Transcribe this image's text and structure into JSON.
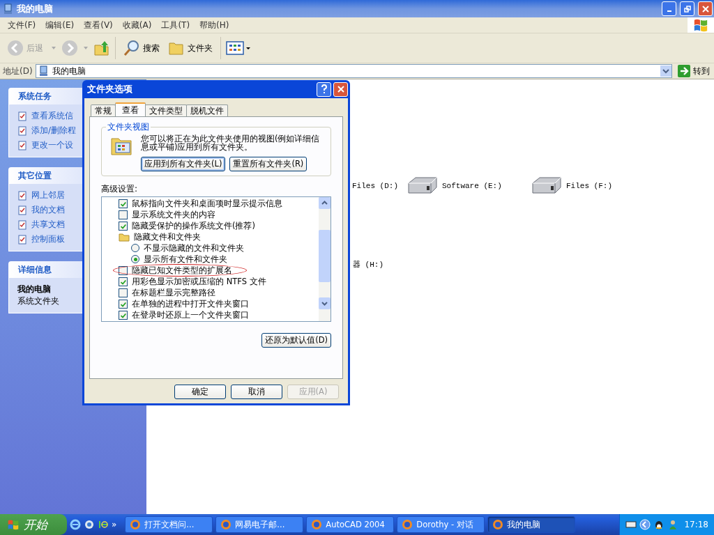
{
  "window": {
    "title": "我的电脑"
  },
  "menu": [
    "文件(F)",
    "编辑(E)",
    "查看(V)",
    "收藏(A)",
    "工具(T)",
    "帮助(H)"
  ],
  "toolbar": {
    "back": {
      "label": "后退",
      "disabled": true
    },
    "search": "搜索",
    "folders": "文件夹"
  },
  "address": {
    "label": "地址(D)",
    "value": "我的电脑",
    "go": "转到"
  },
  "sidebar": {
    "panels": [
      {
        "title": "系统任务",
        "items": [
          "查看系统信",
          "添加/删除程",
          "更改一个设"
        ]
      },
      {
        "title": "其它位置",
        "items": [
          "网上邻居",
          "我的文档",
          "共享文档",
          "控制面板"
        ]
      }
    ],
    "details": {
      "title": "详细信息",
      "name": "我的电脑",
      "desc": "系统文件夹"
    }
  },
  "drives": [
    [
      {
        "label": "Files (D:)",
        "icon_visible": false
      },
      {
        "label": "Software (E:)",
        "icon_visible": true
      },
      {
        "label": "Files (F:)",
        "icon_visible": true
      }
    ],
    [
      {
        "label": "器 (H:)",
        "icon_visible": false
      }
    ]
  ],
  "dialog": {
    "title": "文件夹选项",
    "tabs": [
      {
        "label": "常规",
        "selected": false
      },
      {
        "label": "查看",
        "selected": true
      },
      {
        "label": "文件类型",
        "selected": false
      },
      {
        "label": "脱机文件",
        "selected": false
      }
    ],
    "group": {
      "title": "文件夹视图",
      "text": "您可以将正在为此文件夹使用的视图(例如详细信息或平铺)应用到所有文件夹。",
      "buttons": [
        "应用到所有文件夹(L)",
        "重置所有文件夹(R)"
      ]
    },
    "advanced_label": "高级设置:",
    "settings": [
      {
        "kind": "checkbox",
        "label": "鼠标指向文件夹和桌面项时显示提示信息",
        "checked": true,
        "circled": false
      },
      {
        "kind": "checkbox",
        "label": "显示系统文件夹的内容",
        "checked": false,
        "circled": false
      },
      {
        "kind": "checkbox",
        "label": "隐藏受保护的操作系统文件(推荐)",
        "checked": true,
        "circled": false
      },
      {
        "kind": "folder",
        "label": "隐藏文件和文件夹",
        "children": [
          {
            "kind": "radio",
            "label": "不显示隐藏的文件和文件夹",
            "selected": false
          },
          {
            "kind": "radio",
            "label": "显示所有文件和文件夹",
            "selected": true
          }
        ]
      },
      {
        "kind": "checkbox",
        "label": "隐藏已知文件类型的扩展名",
        "checked": false,
        "circled": true
      },
      {
        "kind": "checkbox",
        "label": "用彩色显示加密或压缩的 NTFS 文件",
        "checked": true,
        "circled": false
      },
      {
        "kind": "checkbox",
        "label": "在标题栏显示完整路径",
        "checked": false,
        "circled": false
      },
      {
        "kind": "checkbox",
        "label": "在单独的进程中打开文件夹窗口",
        "checked": true,
        "circled": false
      },
      {
        "kind": "checkbox",
        "label": "在登录时还原上一个文件夹窗口",
        "checked": true,
        "circled": false
      }
    ],
    "restore": "还原为默认值(D)",
    "buttons": [
      {
        "label": "确定",
        "disabled": false
      },
      {
        "label": "取消",
        "disabled": false
      },
      {
        "label": "应用(A)",
        "disabled": true
      }
    ]
  },
  "taskbar": {
    "start": "开始",
    "more": "»",
    "tasks": [
      {
        "label": "打开文档问...",
        "selected": false
      },
      {
        "label": "网易电子邮...",
        "selected": false
      },
      {
        "label": "AutoCAD 2004",
        "selected": false
      },
      {
        "label": "Dorothy - 对话",
        "selected": false
      },
      {
        "label": "我的电脑",
        "selected": true
      }
    ],
    "clock": "17:18"
  }
}
